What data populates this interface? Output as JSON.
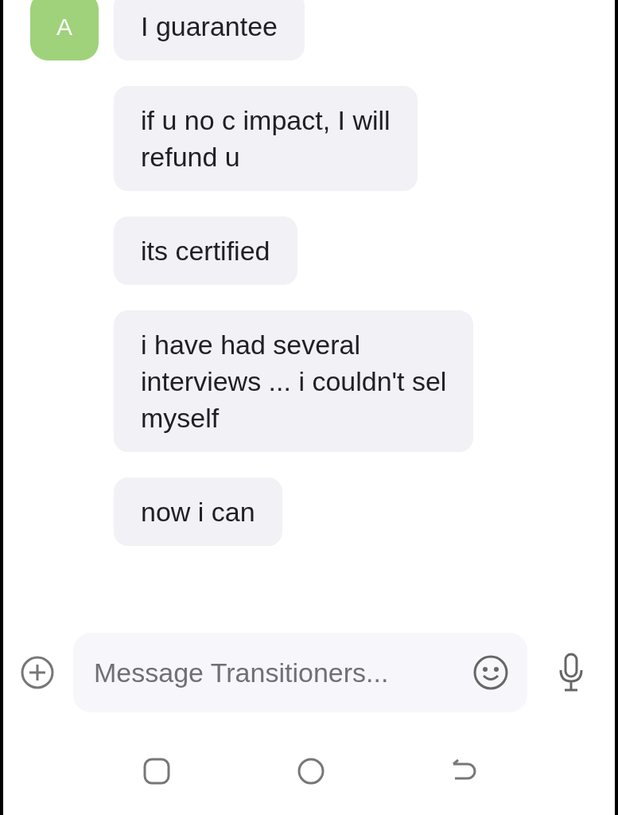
{
  "avatar": {
    "letter": "A",
    "color": "#9fd27a"
  },
  "messages": [
    {
      "text": "I guarantee"
    },
    {
      "text": "if u no c impact, I will\nrefund u"
    },
    {
      "text": "its certified"
    },
    {
      "text": "i have had several\ninterviews ... i couldn't sel\nmyself"
    },
    {
      "text": "now i can"
    }
  ],
  "composer": {
    "placeholder": "Message Transitioners..."
  }
}
